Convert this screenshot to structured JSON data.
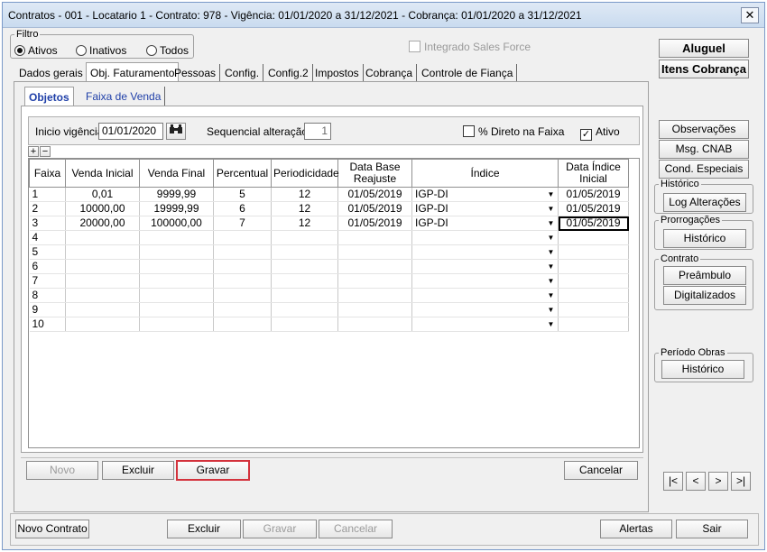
{
  "window": {
    "title": "Contratos - 001 - Locatario 1 - Contrato: 978 - Vigência: 01/01/2020 a 31/12/2021 - Cobrança: 01/01/2020 a 31/12/2021",
    "close_symbol": "✕"
  },
  "filter": {
    "legend": "Filtro",
    "options": [
      {
        "label": "Ativos",
        "selected": true
      },
      {
        "label": "Inativos",
        "selected": false
      },
      {
        "label": "Todos",
        "selected": false
      }
    ],
    "sales_force_label": "Integrado Sales Force"
  },
  "tabs": [
    {
      "label": "Dados gerais",
      "active": false
    },
    {
      "label": "Obj. Faturamento",
      "active": true
    },
    {
      "label": "Pessoas",
      "active": false
    },
    {
      "label": "Config.",
      "active": false
    },
    {
      "label": "Config.2",
      "active": false
    },
    {
      "label": "Impostos",
      "active": false
    },
    {
      "label": "Cobrança",
      "active": false
    },
    {
      "label": "Controle de Fiança",
      "active": false
    }
  ],
  "subtabs": [
    {
      "label": "Objetos",
      "active": true
    },
    {
      "label": "Faixa de Venda",
      "active": false
    }
  ],
  "form": {
    "inicio_vigencia_label": "Inicio vigência",
    "inicio_vigencia_value": "01/01/2020",
    "sequencial_label": "Sequencial alteração",
    "sequencial_value": "1",
    "direto_label": "% Direto na Faixa",
    "direto_checked": false,
    "ativo_label": "Ativo",
    "ativo_checked": true,
    "expand_symbol": "+",
    "collapse_symbol": "−",
    "binoculars_icon": "binoculars-icon"
  },
  "grid": {
    "columns": [
      "Faixa",
      "Venda Inicial",
      "Venda Final",
      "Percentual",
      "Periodicidade",
      "Data Base Reajuste",
      "Índice",
      "Data Índice Inicial"
    ],
    "rows": [
      [
        "1",
        "0,01",
        "9999,99",
        "5",
        "12",
        "01/05/2019",
        "IGP-DI",
        "01/05/2019"
      ],
      [
        "2",
        "10000,00",
        "19999,99",
        "6",
        "12",
        "01/05/2019",
        "IGP-DI",
        "01/05/2019"
      ],
      [
        "3",
        "20000,00",
        "100000,00",
        "7",
        "12",
        "01/05/2019",
        "IGP-DI",
        "01/05/2019"
      ],
      [
        "4",
        "",
        "",
        "",
        "",
        "",
        "",
        ""
      ],
      [
        "5",
        "",
        "",
        "",
        "",
        "",
        "",
        ""
      ],
      [
        "6",
        "",
        "",
        "",
        "",
        "",
        "",
        ""
      ],
      [
        "7",
        "",
        "",
        "",
        "",
        "",
        "",
        ""
      ],
      [
        "8",
        "",
        "",
        "",
        "",
        "",
        "",
        ""
      ],
      [
        "9",
        "",
        "",
        "",
        "",
        "",
        "",
        ""
      ],
      [
        "10",
        "",
        "",
        "",
        "",
        "",
        "",
        ""
      ]
    ],
    "dropdown_symbol": "▼"
  },
  "inner_buttons": {
    "novo": "Novo",
    "excluir": "Excluir",
    "gravar": "Gravar",
    "cancelar": "Cancelar"
  },
  "right_panel": {
    "aluguel": "Aluguel",
    "itens_cobranca": "Itens Cobrança",
    "observacoes": "Observações",
    "msg_cnab": "Msg. CNAB",
    "cond_especiais": "Cond. Especiais",
    "historico_legend": "Histórico",
    "log_alteracoes": "Log Alterações",
    "prorrogacoes_legend": "Prorrogações",
    "prorrogacoes_historico": "Histórico",
    "contrato_legend": "Contrato",
    "preambulo": "Preâmbulo",
    "digitalizados": "Digitalizados",
    "periodo_obras_legend": "Período Obras",
    "periodo_obras_historico": "Histórico",
    "nav": [
      "|<",
      "<",
      ">",
      ">|"
    ]
  },
  "footer": {
    "novo_contrato": "Novo Contrato",
    "excluir": "Excluir",
    "gravar": "Gravar",
    "cancelar": "Cancelar",
    "alertas": "Alertas",
    "sair": "Sair"
  }
}
